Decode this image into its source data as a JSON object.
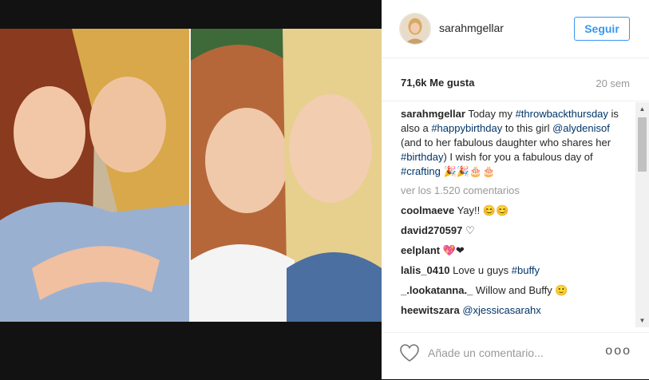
{
  "post": {
    "username": "sarahmgellar",
    "follow_label": "Seguir",
    "likes": "71,6k Me gusta",
    "age": "20 sem"
  },
  "caption": {
    "author": "sarahmgellar",
    "t1": " Today my ",
    "tag1": "#throwbackthursday",
    "t2": " is also a ",
    "tag2": "#happybirthday",
    "t3": " to this girl ",
    "mention": "@alydenisof",
    "t4": " (and to her fabulous daughter who shares her ",
    "tag3": "#birthday",
    "t5": ") I wish for you a fabulous day of ",
    "tag4": "#crafting",
    "t6": " 🎉🎉🎂🎂"
  },
  "view_all": "ver los 1.520 comentarios",
  "comments": [
    {
      "author": "coolmaeve",
      "text": " Yay!! 😊😊",
      "tag": ""
    },
    {
      "author": "david270597",
      "text": " ♡",
      "tag": ""
    },
    {
      "author": "eelplant",
      "text": " 💖❤",
      "tag": ""
    },
    {
      "author": "lalis_0410",
      "text": " Love u guys ",
      "tag": "#buffy"
    },
    {
      "author": "_.lookatanna._",
      "text": " Willow and Buffy 🙂",
      "tag": ""
    },
    {
      "author": "heewitszara",
      "text": " ",
      "tag": "@xjessicasarahx"
    }
  ],
  "footer": {
    "comment_placeholder": "Añade un comentario...",
    "more_label": "ooo"
  },
  "icons": {
    "heart": "heart-icon",
    "more": "more-options-icon",
    "scroll_up": "scroll-up-arrow-icon",
    "scroll_down": "scroll-down-arrow-icon"
  },
  "colors": {
    "accent": "#3897f0",
    "tag": "#003569",
    "muted": "#999999"
  }
}
